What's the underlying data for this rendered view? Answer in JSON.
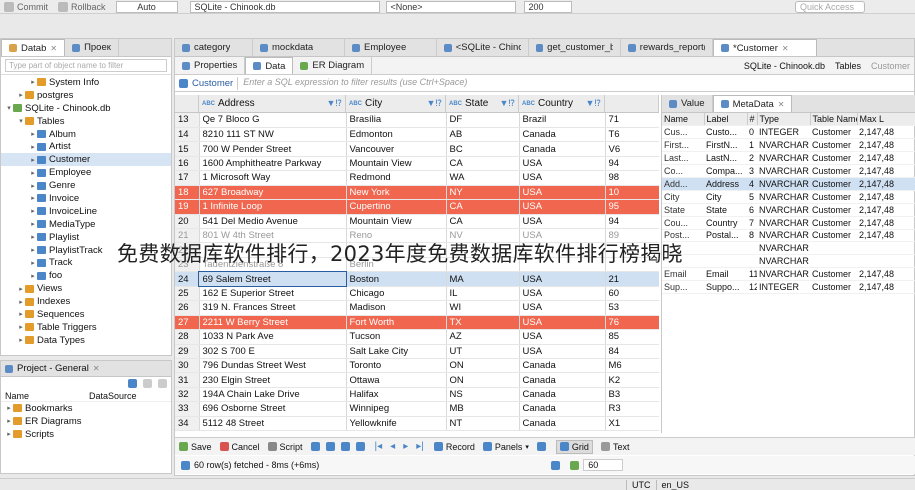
{
  "toolbar": {
    "commit": "Commit",
    "rollback": "Rollback",
    "auto": "Auto",
    "connection": "SQLite - Chinook.db",
    "schema": "<None>",
    "limit": "200",
    "quick_access": "Quick Access"
  },
  "nav": {
    "tabs": [
      "Datab",
      "Проек"
    ],
    "filter_placeholder": "Type part of object name to filter",
    "tree": [
      {
        "label": "System Info",
        "level": 2,
        "tri": "▸",
        "color": "org"
      },
      {
        "label": "postgres",
        "level": 1,
        "tri": "▸",
        "color": "org"
      },
      {
        "label": "SQLite - Chinook.db",
        "level": 0,
        "tri": "▾",
        "color": "gr"
      },
      {
        "label": "Tables",
        "level": 1,
        "tri": "▾",
        "color": "org"
      },
      {
        "label": "Album",
        "level": 2,
        "tri": "▸",
        "color": "b"
      },
      {
        "label": "Artist",
        "level": 2,
        "tri": "▸",
        "color": "b"
      },
      {
        "label": "Customer",
        "level": 2,
        "tri": "▸",
        "color": "b",
        "selected": true
      },
      {
        "label": "Employee",
        "level": 2,
        "tri": "▸",
        "color": "b"
      },
      {
        "label": "Genre",
        "level": 2,
        "tri": "▸",
        "color": "b"
      },
      {
        "label": "Invoice",
        "level": 2,
        "tri": "▸",
        "color": "b"
      },
      {
        "label": "InvoiceLine",
        "level": 2,
        "tri": "▸",
        "color": "b"
      },
      {
        "label": "MediaType",
        "level": 2,
        "tri": "▸",
        "color": "b"
      },
      {
        "label": "Playlist",
        "level": 2,
        "tri": "▸",
        "color": "b"
      },
      {
        "label": "PlaylistTrack",
        "level": 2,
        "tri": "▸",
        "color": "b"
      },
      {
        "label": "Track",
        "level": 2,
        "tri": "▸",
        "color": "b"
      },
      {
        "label": "foo",
        "level": 2,
        "tri": "▸",
        "color": "b"
      },
      {
        "label": "Views",
        "level": 1,
        "tri": "▸",
        "color": "org"
      },
      {
        "label": "Indexes",
        "level": 1,
        "tri": "▸",
        "color": "org"
      },
      {
        "label": "Sequences",
        "level": 1,
        "tri": "▸",
        "color": "org"
      },
      {
        "label": "Table Triggers",
        "level": 1,
        "tri": "▸",
        "color": "org"
      },
      {
        "label": "Data Types",
        "level": 1,
        "tri": "▸",
        "color": "org"
      }
    ]
  },
  "project": {
    "title": "Project - General",
    "col_name": "Name",
    "col_source": "DataSource",
    "items": [
      "Bookmarks",
      "ER Diagrams",
      "Scripts"
    ]
  },
  "editor_tabs": [
    "category",
    "mockdata",
    "Employee",
    "<SQLite - Chino",
    "get_customer_ba",
    "rewards_report(",
    "*Customer"
  ],
  "subtabs": [
    "Properties",
    "Data",
    "ER Diagram"
  ],
  "right_info": {
    "connection": "SQLite - Chinook.db",
    "tables": "Tables",
    "customer": "Customer"
  },
  "filter": {
    "label": "Customer",
    "placeholder": "Enter a SQL expression to filter results (use Ctrl+Space)"
  },
  "columns": [
    "Address",
    "City",
    "State",
    "Country",
    ""
  ],
  "rows": [
    {
      "n": "13",
      "address": "Qe 7 Bloco G",
      "city": "Brasília",
      "state": "DF",
      "country": "Brazil",
      "extra": "71",
      "style": ""
    },
    {
      "n": "14",
      "address": "8210 111 ST NW",
      "city": "Edmonton",
      "state": "AB",
      "country": "Canada",
      "extra": "T6",
      "style": ""
    },
    {
      "n": "15",
      "address": "700 W Pender Street",
      "city": "Vancouver",
      "state": "BC",
      "country": "Canada",
      "extra": "V6",
      "style": ""
    },
    {
      "n": "16",
      "address": "1600 Amphitheatre Parkway",
      "city": "Mountain View",
      "state": "CA",
      "country": "USA",
      "extra": "94",
      "style": ""
    },
    {
      "n": "17",
      "address": "1 Microsoft Way",
      "city": "Redmond",
      "state": "WA",
      "country": "USA",
      "extra": "98",
      "style": ""
    },
    {
      "n": "18",
      "address": "627 Broadway",
      "city": "New York",
      "state": "NY",
      "country": "USA",
      "extra": "10",
      "style": "hi"
    },
    {
      "n": "19",
      "address": "1 Infinite Loop",
      "city": "Cupertino",
      "state": "CA",
      "country": "USA",
      "extra": "95",
      "style": "hi"
    },
    {
      "n": "20",
      "address": "541 Del Medio Avenue",
      "city": "Mountain View",
      "state": "CA",
      "country": "USA",
      "extra": "94",
      "style": ""
    },
    {
      "n": "21",
      "address": "801 W 4th Street",
      "city": "Reno",
      "state": "NV",
      "country": "USA",
      "extra": "89",
      "style": "faded"
    },
    {
      "n": "22",
      "address": "",
      "city": "",
      "state": "",
      "country": "",
      "extra": "",
      "style": "faded"
    },
    {
      "n": "23",
      "address": "Tauentzienstraße 8",
      "city": "Berlin",
      "state": "",
      "country": "",
      "extra": "",
      "style": "faded"
    },
    {
      "n": "24",
      "address": "69 Salem Street",
      "city": "Boston",
      "state": "MA",
      "country": "USA",
      "extra": "21",
      "style": "selrow"
    },
    {
      "n": "25",
      "address": "162 E Superior Street",
      "city": "Chicago",
      "state": "IL",
      "country": "USA",
      "extra": "60",
      "style": ""
    },
    {
      "n": "26",
      "address": "319 N. Frances Street",
      "city": "Madison",
      "state": "WI",
      "country": "USA",
      "extra": "53",
      "style": ""
    },
    {
      "n": "27",
      "address": "2211 W Berry Street",
      "city": "Fort Worth",
      "state": "TX",
      "country": "USA",
      "extra": "76",
      "style": "hi"
    },
    {
      "n": "28",
      "address": "1033 N Park Ave",
      "city": "Tucson",
      "state": "AZ",
      "country": "USA",
      "extra": "85",
      "style": ""
    },
    {
      "n": "29",
      "address": "302 S 700 E",
      "city": "Salt Lake City",
      "state": "UT",
      "country": "USA",
      "extra": "84",
      "style": ""
    },
    {
      "n": "30",
      "address": "796 Dundas Street West",
      "city": "Toronto",
      "state": "ON",
      "country": "Canada",
      "extra": "M6",
      "style": ""
    },
    {
      "n": "31",
      "address": "230 Elgin Street",
      "city": "Ottawa",
      "state": "ON",
      "country": "Canada",
      "extra": "K2",
      "style": ""
    },
    {
      "n": "32",
      "address": "194A Chain Lake Drive",
      "city": "Halifax",
      "state": "NS",
      "country": "Canada",
      "extra": "B3",
      "style": ""
    },
    {
      "n": "33",
      "address": "696 Osborne Street",
      "city": "Winnipeg",
      "state": "MB",
      "country": "Canada",
      "extra": "R3",
      "style": ""
    },
    {
      "n": "34",
      "address": "5112 48 Street",
      "city": "Yellowknife",
      "state": "NT",
      "country": "Canada",
      "extra": "X1",
      "style": ""
    }
  ],
  "bottom_toolbar": {
    "save": "Save",
    "cancel": "Cancel",
    "script": "Script",
    "record": "Record",
    "panels": "Panels",
    "grid": "Grid",
    "text": "Text"
  },
  "status": {
    "fetched": "60 row(s) fetched - 8ms (+6ms)",
    "count": "60"
  },
  "meta": {
    "tabs": [
      "Value",
      "MetaData"
    ],
    "headers": [
      "Name",
      "Label",
      "#",
      "Type",
      "Table Name",
      "Max L"
    ],
    "rows": [
      [
        "Cus...",
        "Custo...",
        "0",
        "INTEGER",
        "Customer",
        "2,147,48"
      ],
      [
        "First...",
        "FirstN...",
        "1",
        "NVARCHAR",
        "Customer",
        "2,147,48"
      ],
      [
        "Last...",
        "LastN...",
        "2",
        "NVARCHAR",
        "Customer",
        "2,147,48"
      ],
      [
        "Co...",
        "Compa...",
        "3",
        "NVARCHAR",
        "Customer",
        "2,147,48"
      ],
      [
        "Add...",
        "Address",
        "4",
        "NVARCHAR",
        "Customer",
        "2,147,48"
      ],
      [
        "City",
        "City",
        "5",
        "NVARCHAR",
        "Customer",
        "2,147,48"
      ],
      [
        "State",
        "State",
        "6",
        "NVARCHAR",
        "Customer",
        "2,147,48"
      ],
      [
        "Cou...",
        "Country",
        "7",
        "NVARCHAR",
        "Customer",
        "2,147,48"
      ],
      [
        "Post...",
        "Postal...",
        "8",
        "NVARCHAR",
        "Customer",
        "2,147,48"
      ],
      [
        "",
        "",
        "",
        "NVARCHAR",
        "",
        ""
      ],
      [
        "",
        "",
        "",
        "NVARCHAR",
        "",
        ""
      ],
      [
        "Email",
        "Email",
        "11",
        "NVARCHAR",
        "Customer",
        "2,147,48"
      ],
      [
        "Sup...",
        "Suppo...",
        "12",
        "INTEGER",
        "Customer",
        "2,147,48"
      ]
    ]
  },
  "statusbar": {
    "tz": "UTC",
    "locale": "en_US"
  },
  "overlay_text": "免费数据库软件排行，2023年度免费数据库软件排行榜揭晓"
}
